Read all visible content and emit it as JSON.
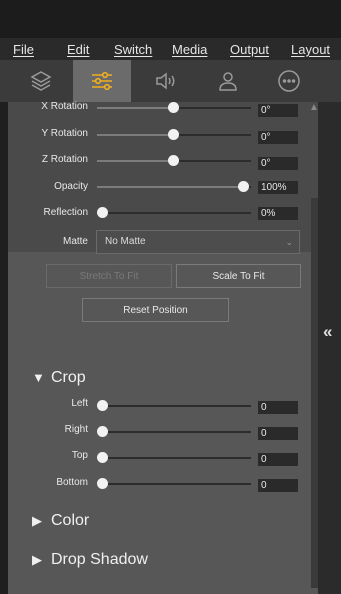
{
  "menu": {
    "file": "File",
    "edit": "Edit",
    "switch": "Switch",
    "media": "Media",
    "output": "Output",
    "layout": "Layout"
  },
  "toolbar": {
    "tabs": [
      {
        "icon": "layers-icon",
        "active": false
      },
      {
        "icon": "sliders-icon",
        "active": true
      },
      {
        "icon": "speaker-icon",
        "active": false
      },
      {
        "icon": "user-icon",
        "active": false
      },
      {
        "icon": "more-icon",
        "active": false
      }
    ],
    "active_color": "#f0b020"
  },
  "transform": {
    "x_rotation": {
      "label": "X Rotation",
      "value": "0°",
      "level": 0.5
    },
    "y_rotation": {
      "label": "Y Rotation",
      "value": "0°",
      "level": 0.5
    },
    "z_rotation": {
      "label": "Z Rotation",
      "value": "0°",
      "level": 0.5
    },
    "opacity": {
      "label": "Opacity",
      "value": "100%",
      "level": 1.0
    },
    "reflection": {
      "label": "Reflection",
      "value": "0%",
      "level": 0.0
    },
    "matte": {
      "label": "Matte",
      "selected": "No Matte"
    }
  },
  "buttons": {
    "stretch_to_fit": "Stretch To Fit",
    "scale_to_fit": "Scale To Fit",
    "reset_position": "Reset Position"
  },
  "crop": {
    "title": "Crop",
    "left": {
      "label": "Left",
      "value": "0",
      "level": 0.0
    },
    "right": {
      "label": "Right",
      "value": "0",
      "level": 0.0
    },
    "top": {
      "label": "Top",
      "value": "0",
      "level": 0.0
    },
    "bottom": {
      "label": "Bottom",
      "value": "0",
      "level": 0.0
    }
  },
  "sections": {
    "color": "Color",
    "drop_shadow": "Drop Shadow"
  },
  "collapse_glyph": "«"
}
